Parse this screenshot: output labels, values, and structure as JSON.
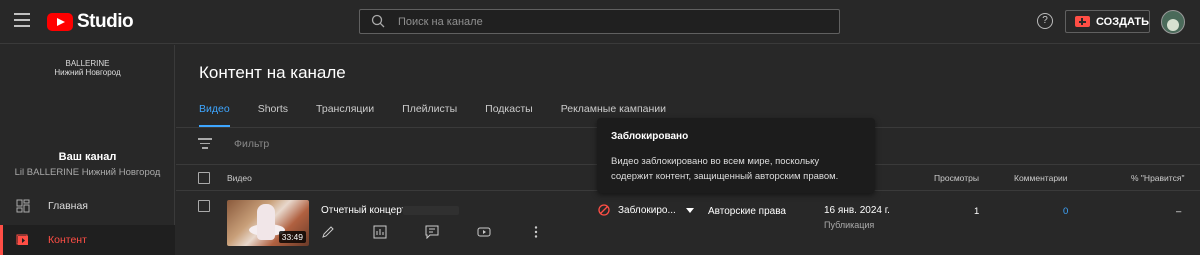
{
  "app": {
    "logo_text": "Studio"
  },
  "search": {
    "placeholder": "Поиск на канале",
    "value": ""
  },
  "header": {
    "create_label": "СОЗДАТЬ"
  },
  "sidebar": {
    "channel_banner_line1": "BALLERINE",
    "channel_banner_line2": "Нижний Новгород",
    "channel_label": "Ваш канал",
    "channel_name": "Lil BALLERINE Нижний Новгород",
    "items": [
      {
        "label": "Главная",
        "icon": "dashboard-icon"
      },
      {
        "label": "Контент",
        "icon": "content-icon",
        "active": true
      }
    ]
  },
  "main": {
    "title": "Контент на канале",
    "tabs": [
      {
        "label": "Видео",
        "active": true
      },
      {
        "label": "Shorts"
      },
      {
        "label": "Трансляции"
      },
      {
        "label": "Плейлисты"
      },
      {
        "label": "Подкасты"
      },
      {
        "label": "Рекламные кампании"
      }
    ],
    "filter_label": "Фильтр",
    "columns": {
      "video": "Видео",
      "views": "Просмотры",
      "comments": "Комментарии",
      "likes": "% \"Нравится\""
    },
    "rows": [
      {
        "duration": "33:49",
        "title": "Отчетный концерт",
        "restriction": "Заблокиро...",
        "restriction_reason": "Авторские права",
        "date": "16 янв. 2024 г.",
        "date_status": "Публикация",
        "views": "1",
        "comments": "0",
        "likes": "–"
      }
    ]
  },
  "tooltip": {
    "title": "Заблокировано",
    "body": "Видео заблокировано во всем мире, поскольку содержит контент, защищенный авторским правом."
  },
  "colors": {
    "accent": "#3ea6ff",
    "brand_red": "#ff0000",
    "active_red": "#ff4e45",
    "background": "#282828"
  }
}
